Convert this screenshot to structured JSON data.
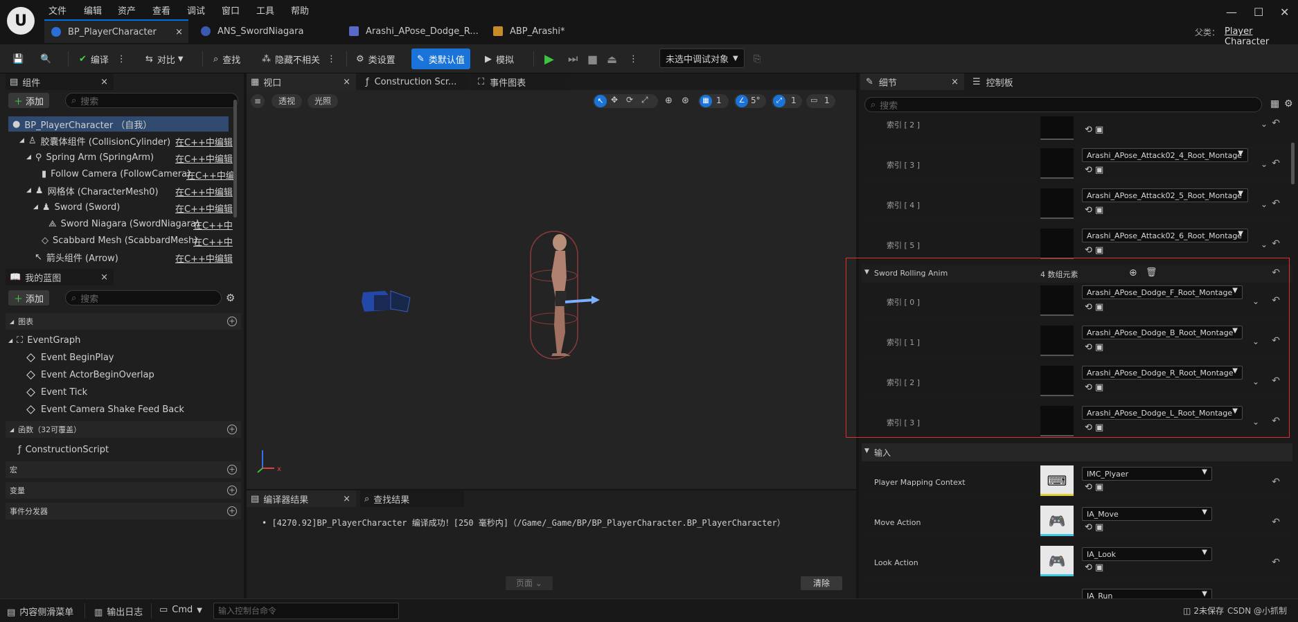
{
  "menu": [
    "文件",
    "编辑",
    "资产",
    "查看",
    "调试",
    "窗口",
    "工具",
    "帮助"
  ],
  "tabs": [
    {
      "label": "BP_PlayerCharacter",
      "close": "×"
    },
    {
      "label": "ANS_SwordNiagara"
    },
    {
      "label": "Arashi_APose_Dodge_R..."
    },
    {
      "label": "ABP_Arashi*"
    }
  ],
  "parent": {
    "label": "父类：",
    "value": "Player Character"
  },
  "toolbar": {
    "save": "",
    "browse": "",
    "compile": "编译",
    "diff": "对比",
    "find": "查找",
    "hide_unrelated": "隐藏不相关",
    "class_settings": "类设置",
    "class_defaults": "类默认值",
    "simulate": "模拟",
    "debug_target": "未选中调试对象"
  },
  "components": {
    "title": "组件",
    "add": "添加",
    "search_placeholder": "搜索",
    "items": [
      {
        "label": "BP_PlayerCharacter （自我）"
      },
      {
        "label": "胶囊体组件 (CollisionCylinder)",
        "edit": "在C++中编辑"
      },
      {
        "label": "Spring Arm (SpringArm)",
        "edit": "在C++中编辑"
      },
      {
        "label": "Follow Camera (FollowCamera)",
        "edit": "在C++中编"
      },
      {
        "label": "网格体 (CharacterMesh0)",
        "edit": "在C++中编辑"
      },
      {
        "label": "Sword (Sword)",
        "edit": "在C++中编辑"
      },
      {
        "label": "Sword Niagara (SwordNiagara)",
        "edit": "在C++中"
      },
      {
        "label": "Scabbard Mesh (ScabbardMesh)",
        "edit": "在C++中"
      },
      {
        "label": "箭头组件 (Arrow)",
        "edit": "在C++中编辑"
      }
    ]
  },
  "myblueprint": {
    "title": "我的蓝图",
    "add": "添加",
    "search_placeholder": "搜索",
    "graphs_label": "图表",
    "event_graph": "EventGraph",
    "events": [
      "Event BeginPlay",
      "Event ActorBeginOverlap",
      "Event Tick",
      "Event Camera Shake Feed Back"
    ],
    "functions_label": "函数（32可覆盖）",
    "construction": "ConstructionScript",
    "macros": "宏",
    "variables": "变量",
    "dispatchers": "事件分发器"
  },
  "viewport": {
    "tabs": [
      "视口",
      "Construction Scr...",
      "事件图表"
    ],
    "perspective": "透视",
    "lit": "光照",
    "grid": "1",
    "angle": "5°",
    "scale": "1",
    "camspeed": "1"
  },
  "compiler": {
    "tab": "编译器结果",
    "find_tab": "查找结果",
    "message": "[4270.92]BP_PlayerCharacter 编译成功！[250 毫秒内]（/Game/_Game/BP/BP_PlayerCharacter.BP_PlayerCharacter）",
    "page": "页面",
    "clear": "清除"
  },
  "details": {
    "tab": "细节",
    "tab2": "控制板",
    "search_placeholder": "搜索",
    "attack_rows": [
      {
        "index": "索引 [ 2 ]",
        "value": ""
      },
      {
        "index": "索引 [ 3 ]",
        "value": "Arashi_APose_Attack02_4_Root_Montage"
      },
      {
        "index": "索引 [ 4 ]",
        "value": "Arashi_APose_Attack02_5_Root_Montage"
      },
      {
        "index": "索引 [ 5 ]",
        "value": "Arashi_APose_Attack02_6_Root_Montage"
      }
    ],
    "rolling": {
      "label": "Sword Rolling Anim",
      "count": "4 数组元素",
      "rows": [
        {
          "index": "索引 [ 0 ]",
          "value": "Arashi_APose_Dodge_F_Root_Montage"
        },
        {
          "index": "索引 [ 1 ]",
          "value": "Arashi_APose_Dodge_B_Root_Montage"
        },
        {
          "index": "索引 [ 2 ]",
          "value": "Arashi_APose_Dodge_R_Root_Montage"
        },
        {
          "index": "索引 [ 3 ]",
          "value": "Arashi_APose_Dodge_L_Root_Montage"
        }
      ]
    },
    "input": {
      "label": "输入",
      "rows": [
        {
          "label": "Player Mapping Context",
          "value": "IMC_Plyaer"
        },
        {
          "label": "Move Action",
          "value": "IA_Move"
        },
        {
          "label": "Look Action",
          "value": "IA_Look"
        },
        {
          "label": "",
          "value": "IA_Run"
        }
      ]
    }
  },
  "bottom": {
    "content_drawer": "内容侧滑菜单",
    "output_log": "输出日志",
    "cmd": "Cmd",
    "console_placeholder": "输入控制台命令",
    "unsaved": "2未保存",
    "watermark": "CSDN @小抓制"
  },
  "colors": {
    "accent": "#1a73d9",
    "highlight_box": "#e03030",
    "selected": "#2f4a6e"
  }
}
